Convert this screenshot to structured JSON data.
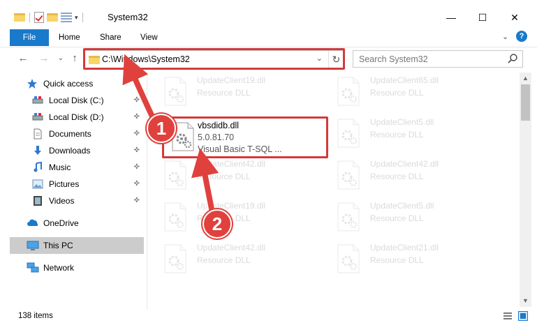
{
  "window": {
    "title": "System32",
    "minimize": "—",
    "maximize": "☐",
    "close": "✕"
  },
  "ribbon": {
    "tabs": [
      "File",
      "Home",
      "Share",
      "View"
    ],
    "expand_glyph": "⌄",
    "help_glyph": "?"
  },
  "navigation": {
    "back": "←",
    "forward": "→",
    "recent": "⌄",
    "up": "↑",
    "address": "C:\\Windows\\System32",
    "address_caret": "⌄",
    "refresh": "↻",
    "search_placeholder": "Search System32"
  },
  "sidebar": {
    "items": [
      {
        "label": "Quick access",
        "icon": "star-icon",
        "pinned": false
      },
      {
        "label": "Local Disk (C:)",
        "icon": "disk-icon",
        "pinned": true
      },
      {
        "label": "Local Disk (D:)",
        "icon": "disk-icon",
        "pinned": true
      },
      {
        "label": "Documents",
        "icon": "documents-icon",
        "pinned": true
      },
      {
        "label": "Downloads",
        "icon": "download-icon",
        "pinned": true
      },
      {
        "label": "Music",
        "icon": "music-icon",
        "pinned": true
      },
      {
        "label": "Pictures",
        "icon": "pictures-icon",
        "pinned": true
      },
      {
        "label": "Videos",
        "icon": "videos-icon",
        "pinned": true
      },
      {
        "label": "OneDrive",
        "icon": "cloud-icon",
        "pinned": false
      },
      {
        "label": "This PC",
        "icon": "computer-icon",
        "pinned": false,
        "selected": true
      },
      {
        "label": "Network",
        "icon": "network-icon",
        "pinned": false
      }
    ],
    "pin_glyph": "📌"
  },
  "files": {
    "faded": [
      {
        "name": "UpdateClient19.dll",
        "desc": "Resource DLL"
      },
      {
        "name": "UpdateClient65.dll",
        "desc": "Resource DLL"
      },
      {
        "name": "UpdateClient5.dll",
        "desc": "Resource DLL"
      },
      {
        "name": "UpdateClient42.dll",
        "desc": "Resource DLL"
      },
      {
        "name": "UpdateClient42.dll",
        "desc": "Resource DLL"
      },
      {
        "name": "UpdateClient19.dll",
        "desc": "Resource DLL"
      },
      {
        "name": "UpdateClient5.dll",
        "desc": "Resource DLL"
      },
      {
        "name": "UpdateClient42.dll",
        "desc": "Resource DLL"
      },
      {
        "name": "UpdateClient21.dll",
        "desc": "Resource DLL"
      }
    ],
    "highlighted": {
      "name": "vbsdidb.dll",
      "version": "5.0.81.70",
      "desc": "Visual Basic T-SQL ..."
    }
  },
  "callouts": [
    "1",
    "2"
  ],
  "status": {
    "item_count": "138 items"
  },
  "colors": {
    "accent": "#1979ca",
    "highlight_red": "#d23a3a",
    "arrow_red": "#e0413d"
  }
}
